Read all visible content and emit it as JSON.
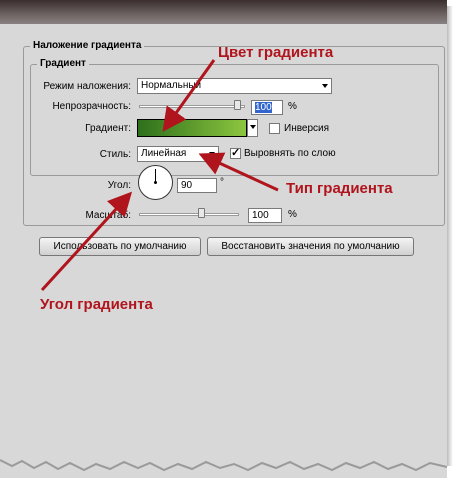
{
  "panel": {
    "outer_legend": "Наложение градиента",
    "inner_legend": "Градиент"
  },
  "fields": {
    "blend_mode_label": "Режим наложения:",
    "blend_mode_value": "Нормальный",
    "opacity_label": "Непрозрачность:",
    "opacity_value": "100",
    "opacity_unit": "%",
    "opacity_level": 1.0,
    "gradient_label": "Градиент:",
    "reverse_label": "Инверсия",
    "reverse_checked": false,
    "style_label": "Стиль:",
    "style_value": "Линейная",
    "align_label": "Выровнять по слою",
    "align_checked": true,
    "angle_label": "Угол:",
    "angle_value": "90",
    "angle_unit": "°",
    "scale_label": "Масштаб:",
    "scale_value": "100",
    "scale_unit": "%",
    "scale_level": 0.6
  },
  "buttons": {
    "default_label": "Использовать по умолчанию",
    "reset_label": "Восстановить значения по умолчанию"
  },
  "annotations": {
    "gradient_color": "Цвет градиента",
    "gradient_type": "Тип градиента",
    "gradient_angle": "Угол градиента"
  },
  "colors": {
    "gradient_start": "#2e6f1c",
    "gradient_end": "#8cc63f",
    "annotation": "#b0141d"
  }
}
